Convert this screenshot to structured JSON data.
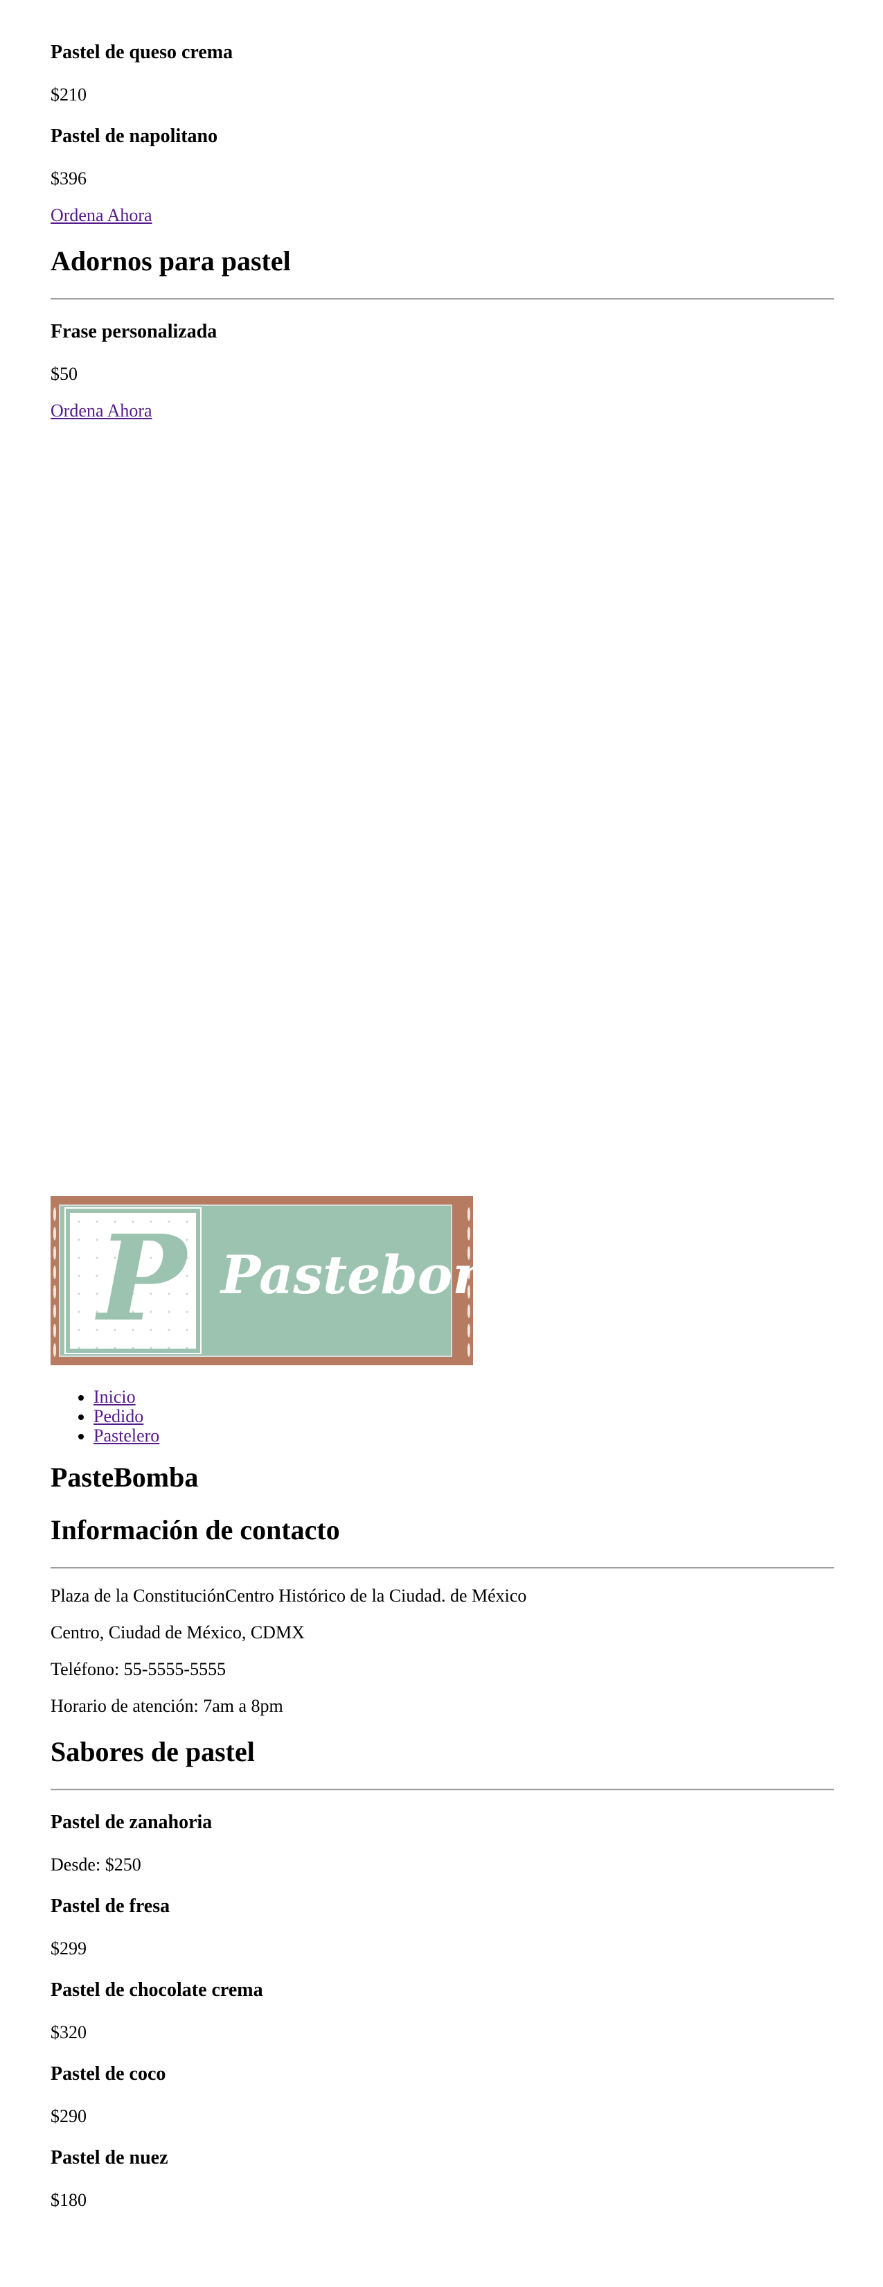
{
  "top_items": [
    {
      "name": "Pastel de queso crema",
      "price": "$210"
    },
    {
      "name": "Pastel de napolitano",
      "price": "$396"
    }
  ],
  "order_link_1": "Ordena Ahora",
  "decorations": {
    "heading": "Adornos para pastel",
    "item_name": "Frase personalizada",
    "item_price": "$50",
    "order_link": "Ordena Ahora"
  },
  "logo": {
    "monogram": "P",
    "wordmark": "Pastebomba",
    "colors": {
      "frame": "#b67b60",
      "mint": "#9cc3b0"
    }
  },
  "nav": [
    "Inicio",
    "Pedido",
    "Pastelero"
  ],
  "site_title": "PasteBomba",
  "contact": {
    "heading": "Información de contacto",
    "address_line_1": "Plaza de la ConstituciónCentro Histórico de la Ciudad. de México",
    "address_line_2": "Centro, Ciudad de México, CDMX",
    "phone": "Teléfono: 55-5555-5555",
    "hours": "Horario de atención: 7am a 8pm"
  },
  "flavors": {
    "heading": "Sabores de pastel",
    "items": [
      {
        "name": "Pastel de zanahoria",
        "price": "Desde: $250"
      },
      {
        "name": "Pastel de fresa",
        "price": "$299"
      },
      {
        "name": "Pastel de chocolate crema",
        "price": "$320"
      },
      {
        "name": "Pastel de coco",
        "price": "$290"
      },
      {
        "name": "Pastel de nuez",
        "price": "$180"
      }
    ]
  },
  "link_color": "#551a8b"
}
